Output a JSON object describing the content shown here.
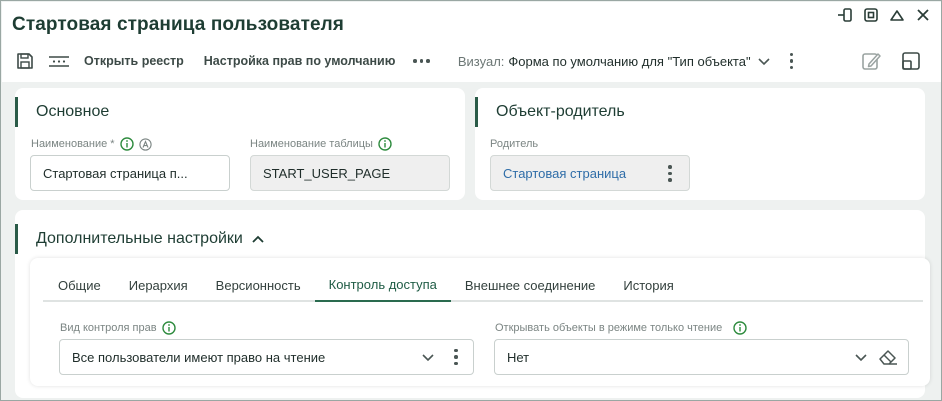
{
  "window": {
    "title": "Стартовая страница пользователя"
  },
  "toolbar": {
    "open_registry": "Открыть реестр",
    "default_rights": "Настройка прав по умолчанию",
    "visual_label": "Визуал:",
    "visual_value": "Форма по умолчанию для \"Тип объекта\""
  },
  "main_card": {
    "title": "Основное",
    "name_label": "Наименование *",
    "name_value": "Стартовая страница п...",
    "table_label": "Наименование таблицы",
    "table_value": "START_USER_PAGE"
  },
  "parent_card": {
    "title": "Объект-родитель",
    "parent_label": "Родитель",
    "parent_value": "Стартовая страница"
  },
  "extra_card": {
    "title": "Дополнительные настройки",
    "tabs": [
      {
        "label": "Общие"
      },
      {
        "label": "Иерархия"
      },
      {
        "label": "Версионность"
      },
      {
        "label": "Контроль доступа"
      },
      {
        "label": "Внешнее соединение"
      },
      {
        "label": "История"
      }
    ],
    "active_tab": "Контроль доступа",
    "access_label": "Вид контроля прав",
    "access_value": "Все пользователи имеют право на чтение",
    "readonly_label": "Открывать объекты в режиме только чтение",
    "readonly_value": "Нет"
  },
  "colors": {
    "accent": "#2a5b48",
    "link": "#2f6da8",
    "info_icon": "#2e8b3e"
  }
}
